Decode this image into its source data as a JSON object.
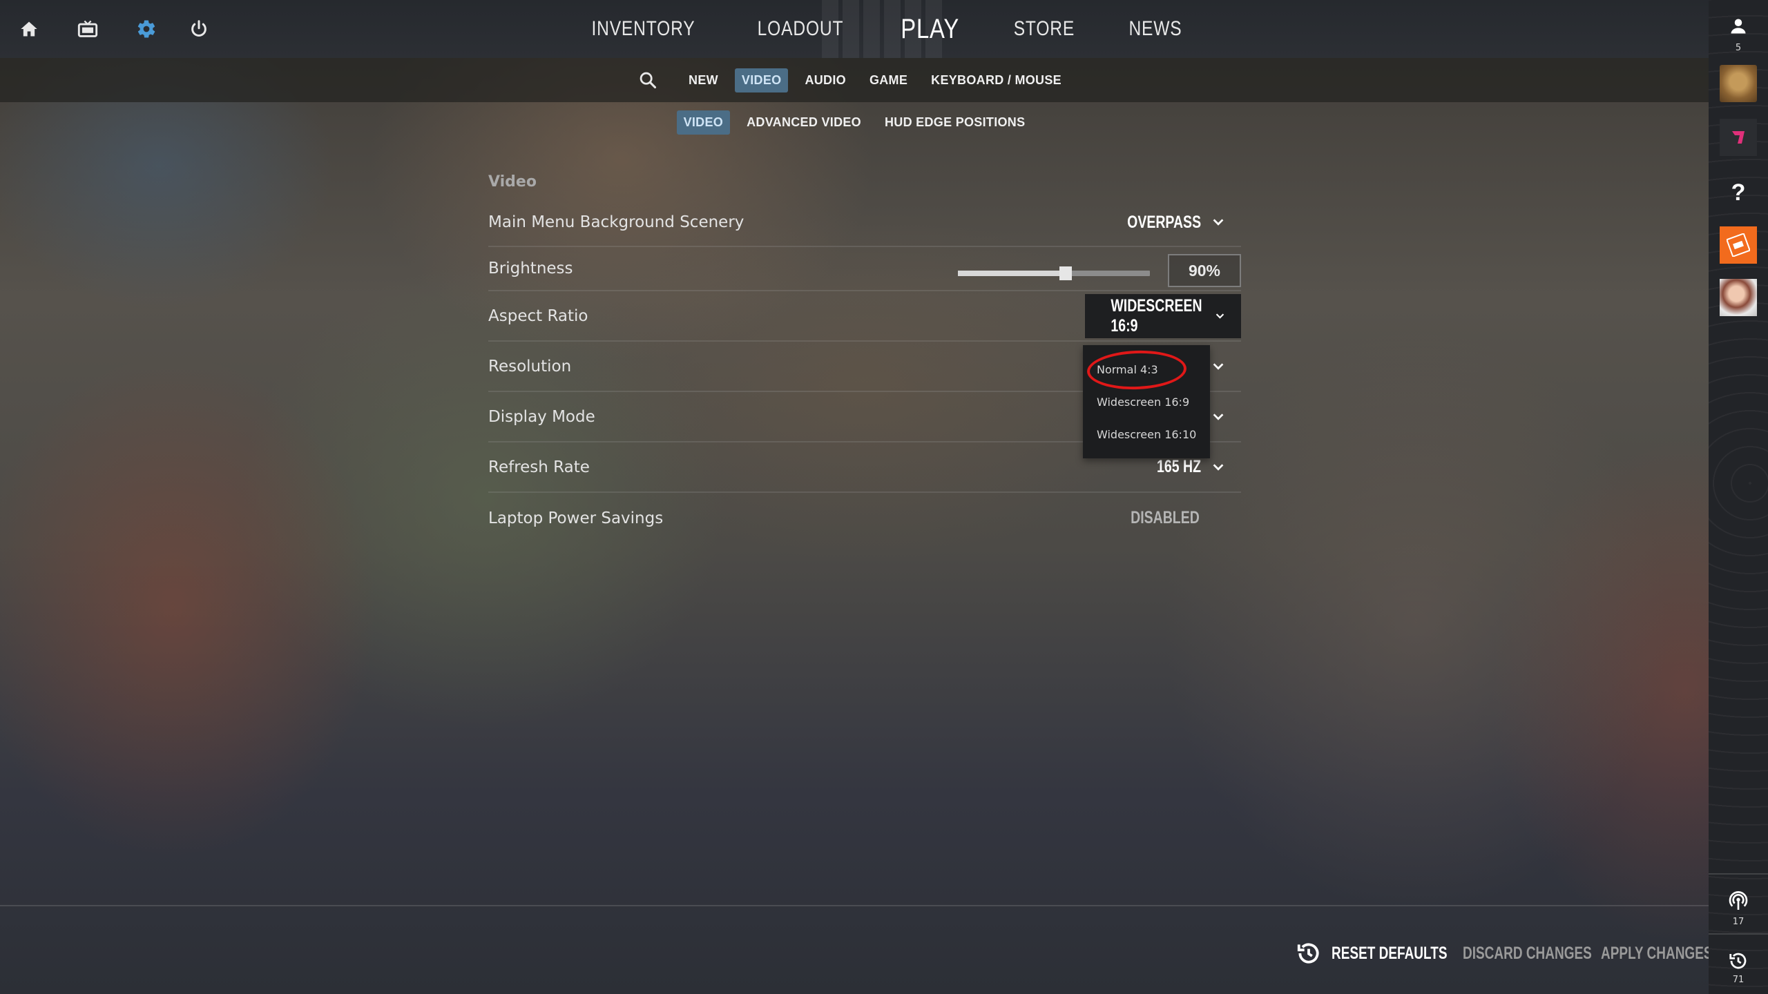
{
  "top_nav": {
    "icons": [
      "home-icon",
      "tv-icon",
      "gear-icon",
      "power-icon"
    ],
    "items": [
      "INVENTORY",
      "LOADOUT",
      "PLAY",
      "STORE",
      "NEWS"
    ]
  },
  "settings_tabs": [
    "NEW",
    "VIDEO",
    "AUDIO",
    "GAME",
    "KEYBOARD / MOUSE"
  ],
  "active_tab": "VIDEO",
  "sub_tabs": [
    "VIDEO",
    "ADVANCED VIDEO",
    "HUD EDGE POSITIONS"
  ],
  "active_sub_tab": "VIDEO",
  "section_title": "Video",
  "settings": {
    "scenery": {
      "label": "Main Menu Background Scenery",
      "value": "OVERPASS"
    },
    "brightness": {
      "label": "Brightness",
      "value": "90%",
      "level": 0.56
    },
    "aspect_ratio": {
      "label": "Aspect Ratio",
      "value": "WIDESCREEN 16:9"
    },
    "resolution": {
      "label": "Resolution"
    },
    "display_mode": {
      "label": "Display Mode"
    },
    "refresh_rate": {
      "label": "Refresh Rate",
      "value": "165 HZ"
    },
    "laptop_power": {
      "label": "Laptop Power Savings",
      "value": "DISABLED"
    }
  },
  "aspect_dropdown": {
    "options": [
      "Normal 4:3",
      "Widescreen 16:9",
      "Widescreen 16:10"
    ],
    "highlighted": "Normal 4:3",
    "highlight_color": "#e01818"
  },
  "bottom_bar": {
    "reset": "RESET DEFAULTS",
    "discard": "DISCARD CHANGES",
    "apply": "APPLY CHANGES"
  },
  "right_rail": {
    "friends_count": "5",
    "broadcast_count": "17",
    "history_count": "71"
  },
  "colors": {
    "accent_tab": "#4b6d86",
    "gear_icon": "#4a9bd8",
    "orange_badge": "#f26b1d"
  }
}
